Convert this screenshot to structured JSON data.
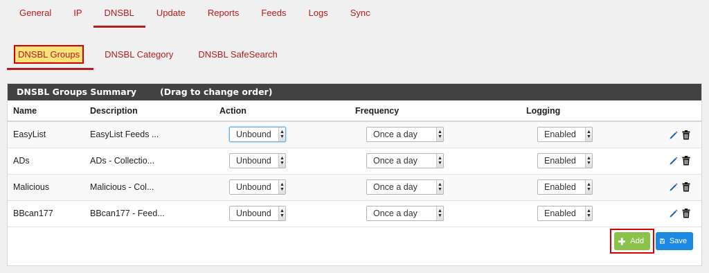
{
  "top_tabs": [
    {
      "label": "General"
    },
    {
      "label": "IP"
    },
    {
      "label": "DNSBL",
      "active": true
    },
    {
      "label": "Update"
    },
    {
      "label": "Reports"
    },
    {
      "label": "Feeds"
    },
    {
      "label": "Logs"
    },
    {
      "label": "Sync"
    }
  ],
  "sub_tabs": [
    {
      "label": "DNSBL Groups",
      "active": true
    },
    {
      "label": "DNSBL Category"
    },
    {
      "label": "DNSBL SafeSearch"
    }
  ],
  "panel": {
    "title": "DNSBL Groups Summary",
    "subtitle": "(Drag to change order)"
  },
  "table": {
    "headers": {
      "name": "Name",
      "description": "Description",
      "action": "Action",
      "frequency": "Frequency",
      "logging": "Logging"
    },
    "rows": [
      {
        "name": "EasyList",
        "description": "EasyList Feeds ...",
        "action": "Unbound",
        "frequency": "Once a day",
        "logging": "Enabled"
      },
      {
        "name": "ADs",
        "description": "ADs - Collectio...",
        "action": "Unbound",
        "frequency": "Once a day",
        "logging": "Enabled"
      },
      {
        "name": "Malicious",
        "description": "Malicious - Col...",
        "action": "Unbound",
        "frequency": "Once a day",
        "logging": "Enabled"
      },
      {
        "name": "BBcan177",
        "description": "BBcan177 - Feed...",
        "action": "Unbound",
        "frequency": "Once a day",
        "logging": "Enabled"
      }
    ]
  },
  "buttons": {
    "add": "Add",
    "save": "Save"
  },
  "colors": {
    "accent": "#b71c1c",
    "highlight_bg": "#ffe27a",
    "highlight_border": "#d50000",
    "panel_heading": "#424242",
    "add_button": "#8bc34a",
    "save_button": "#1e88e5",
    "edit_icon": "#1e63b5"
  },
  "icons": {
    "edit": "pencil-icon",
    "delete": "trash-icon",
    "add": "plus-icon",
    "save": "floppy-disk-icon",
    "select_arrow": "select-arrows-icon"
  }
}
